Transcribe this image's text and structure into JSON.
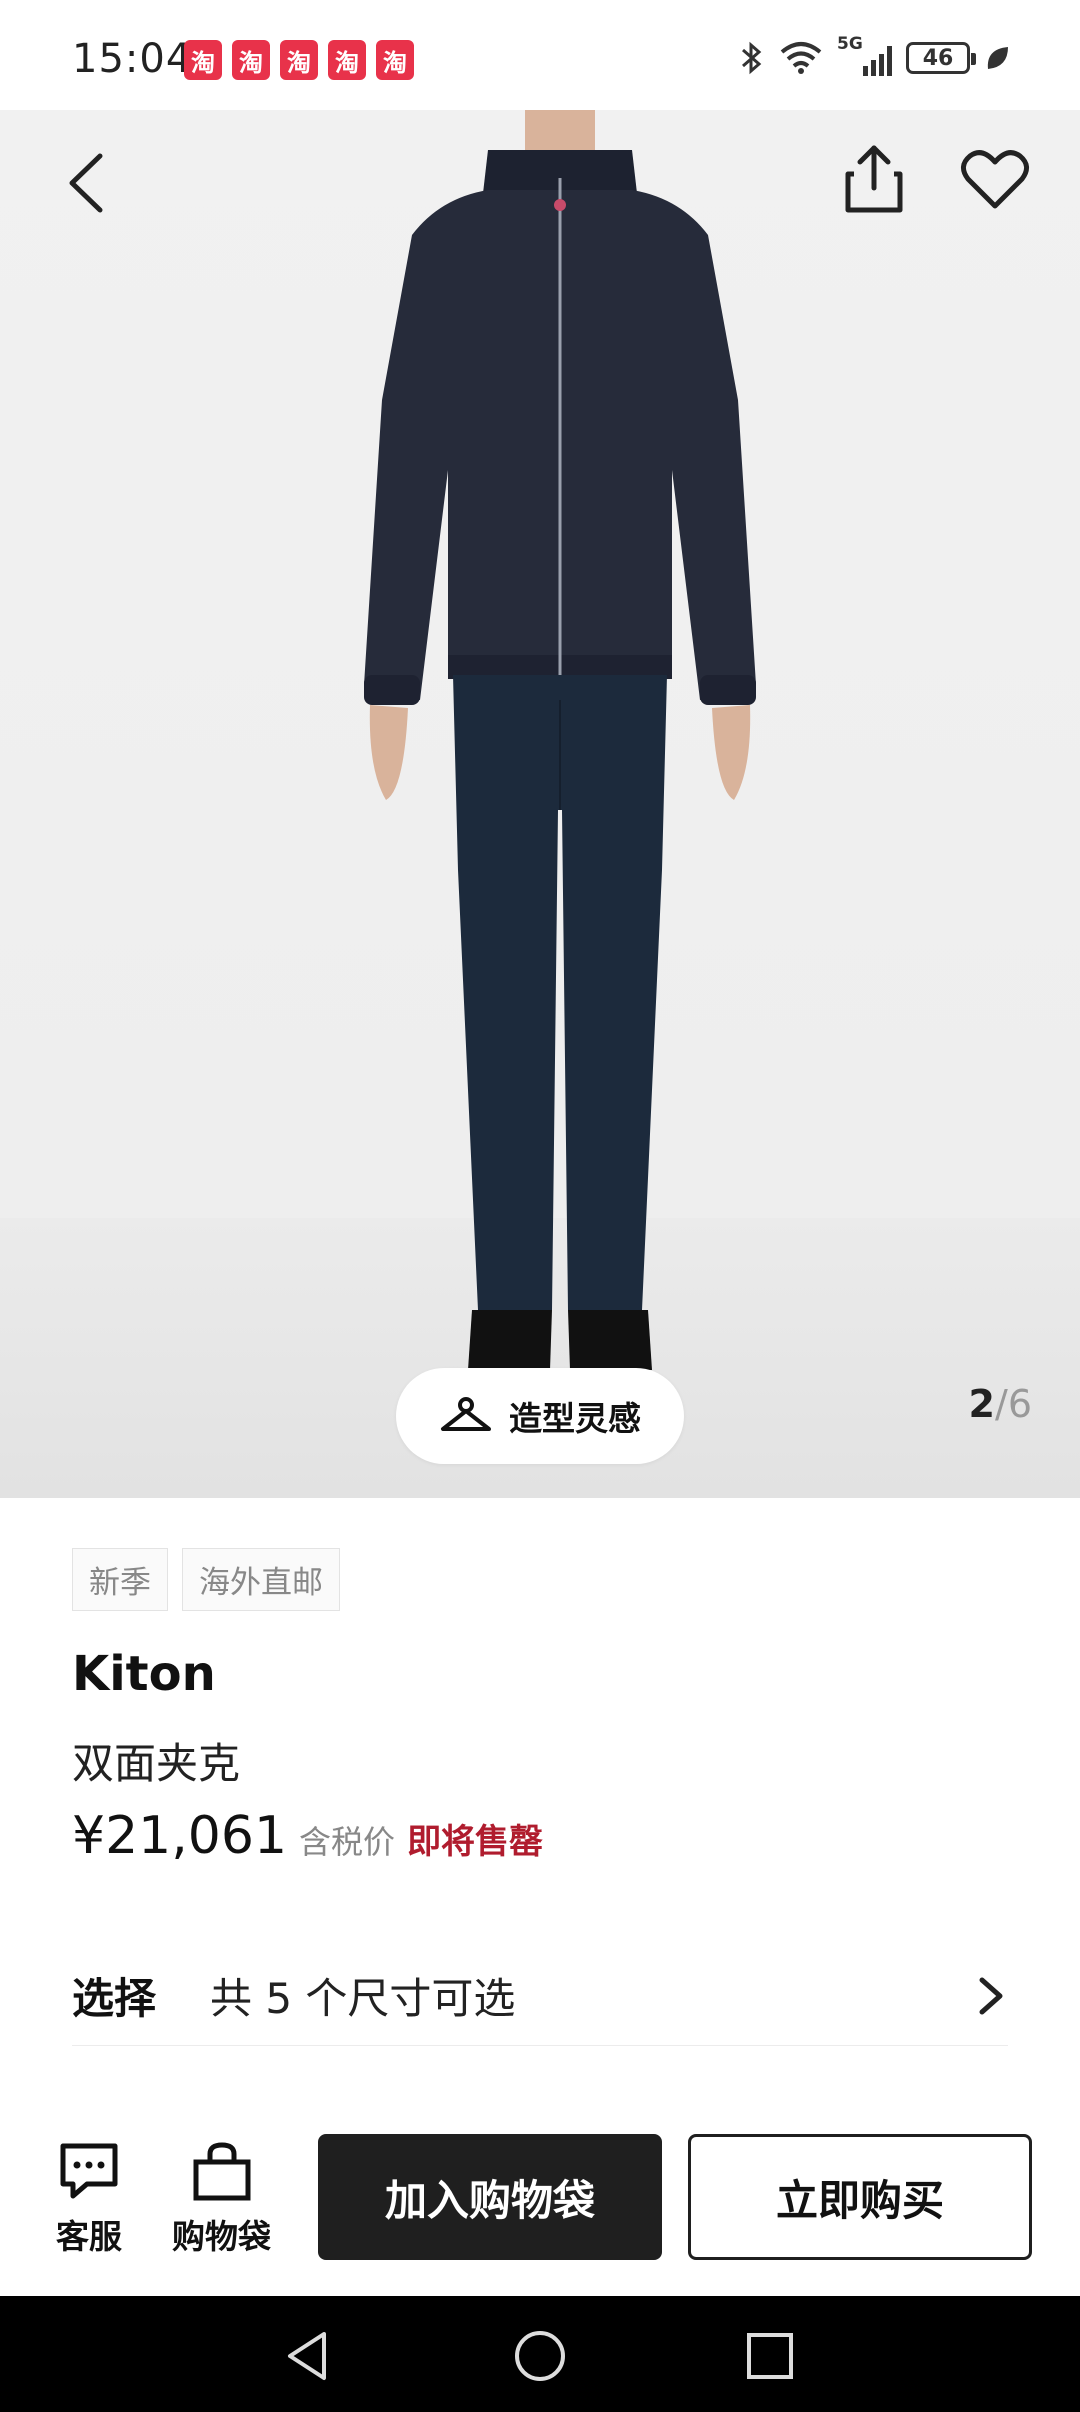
{
  "status": {
    "time": "15:04",
    "app_icons": [
      "淘",
      "淘",
      "淘",
      "淘",
      "淘"
    ],
    "network": "5G",
    "battery": "46"
  },
  "gallery": {
    "styling_label": "造型灵感",
    "current": "2",
    "separator": "/",
    "total": "6"
  },
  "product": {
    "tags": [
      "新季",
      "海外直邮"
    ],
    "brand": "Kiton",
    "name": "双面夹克",
    "price": "¥21,061",
    "tax_note": "含税价",
    "stock_note": "即将售罄"
  },
  "select": {
    "label": "选择",
    "value": "共 5 个尺寸可选"
  },
  "bottom_bar": {
    "service_label": "客服",
    "bag_label": "购物袋",
    "add_to_bag": "加入购物袋",
    "buy_now": "立即购买"
  },
  "colors": {
    "accent_red": "#b01c2e",
    "dark": "#1f1f1f",
    "app_icon": "#e8324a"
  }
}
